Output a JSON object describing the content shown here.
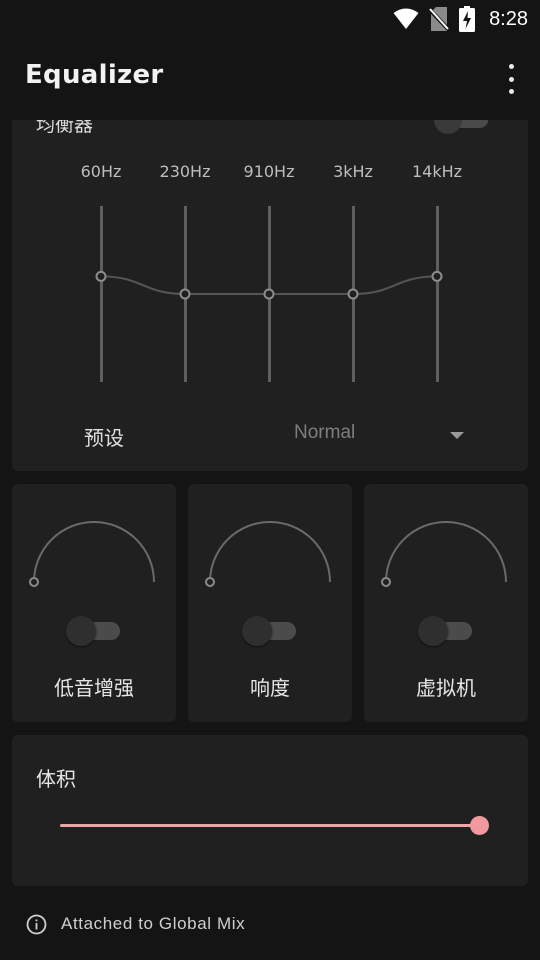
{
  "status_bar": {
    "time": "8:28",
    "icons": [
      "wifi-icon",
      "no-sim-icon",
      "battery-charging-icon"
    ]
  },
  "app_bar": {
    "title": "Equalizer",
    "menu_icon": "more-vert-icon"
  },
  "equalizer": {
    "header_label": "均衡器",
    "enabled": false,
    "bands": [
      {
        "label": "60Hz",
        "level": 0.6
      },
      {
        "label": "230Hz",
        "level": 0.5
      },
      {
        "label": "910Hz",
        "level": 0.5
      },
      {
        "label": "3kHz",
        "level": 0.5
      },
      {
        "label": "14kHz",
        "level": 0.6
      }
    ],
    "preset_label": "预设",
    "preset_value": "Normal"
  },
  "effects": [
    {
      "label": "低音增强",
      "enabled": false,
      "level": 0
    },
    {
      "label": "响度",
      "enabled": false,
      "level": 0
    },
    {
      "label": "虚拟机",
      "enabled": false,
      "level": 0
    }
  ],
  "volume": {
    "label": "体积",
    "level": 1.0
  },
  "footer": {
    "text": "Attached to Global Mix",
    "icon": "info-icon"
  },
  "colors": {
    "accent": "#f09aa0",
    "card": "#202020",
    "background": "#141414"
  }
}
